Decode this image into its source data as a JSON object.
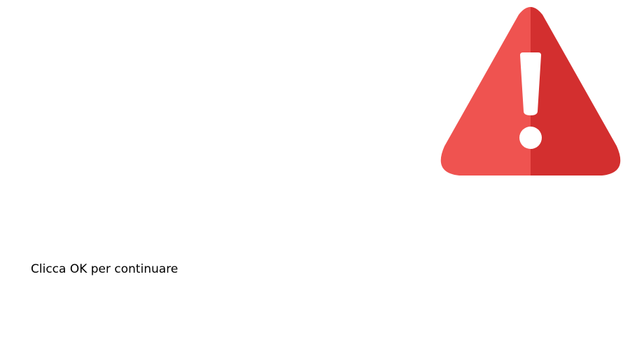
{
  "dialog": {
    "message": "Clicca OK per continuare",
    "icon": "warning-triangle-icon"
  },
  "colors": {
    "background": "#ffffff",
    "icon_light": "#ef5350",
    "icon_dark": "#d32f2f",
    "icon_mark": "#ffffff",
    "text": "#000000"
  }
}
